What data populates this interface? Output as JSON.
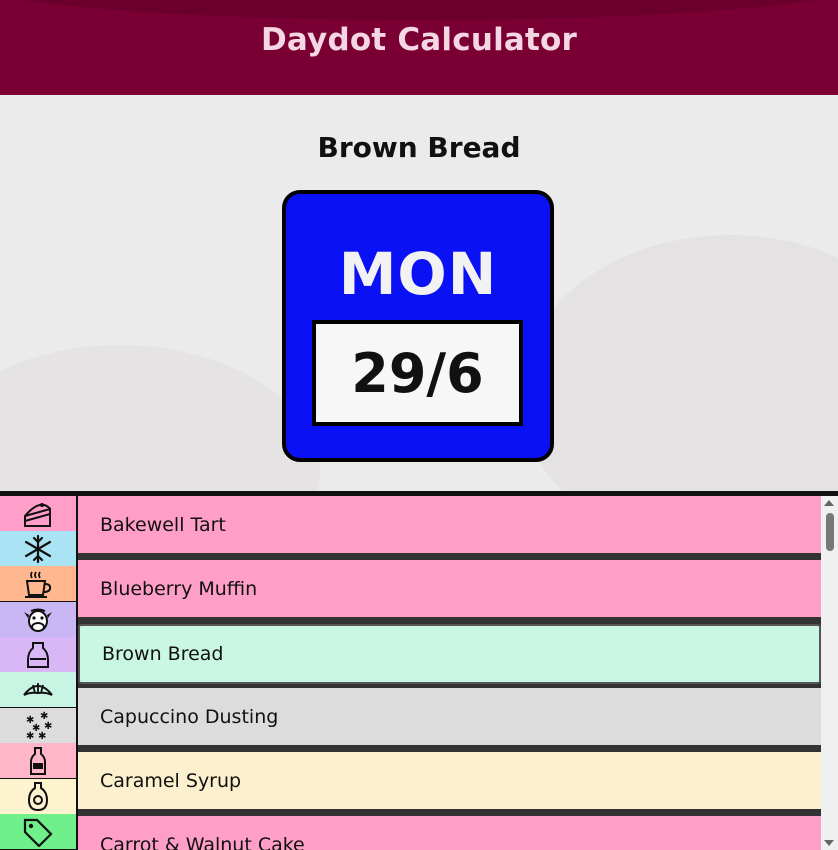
{
  "header": {
    "title": "Daydot Calculator"
  },
  "result": {
    "food_name": "Brown Bread",
    "day": "MON",
    "date": "29/6",
    "daydot_color": "#0a12f5"
  },
  "categories": [
    {
      "name": "cake-icon",
      "color": "#ff9ec8"
    },
    {
      "name": "snowflake-icon",
      "color": "#a9e3f4"
    },
    {
      "name": "hot-drink-icon",
      "color": "#ffb790"
    },
    {
      "name": "cow-icon",
      "color": "#c9b7f5"
    },
    {
      "name": "carafe-icon",
      "color": "#d9b6f5"
    },
    {
      "name": "croissant-icon",
      "color": "#c8f5e3"
    },
    {
      "name": "sprinkles-icon",
      "color": "#dcdcdc"
    },
    {
      "name": "bottle-icon",
      "color": "#ffb6c8"
    },
    {
      "name": "syrup-bottle-icon",
      "color": "#fdf3cf"
    },
    {
      "name": "tag-icon",
      "color": "#6ff08a"
    }
  ],
  "items": [
    {
      "label": "Bakewell Tart",
      "color": "#ff9fc8"
    },
    {
      "label": "Blueberry Muffin",
      "color": "#ff9fc8"
    },
    {
      "label": "Brown Bread",
      "color": "#c9f7e3"
    },
    {
      "label": "Capuccino Dusting",
      "color": "#dcdcdc"
    },
    {
      "label": "Caramel Syrup",
      "color": "#fdf0cf"
    },
    {
      "label": "Carrot & Walnut Cake",
      "color": "#ff9fc8"
    }
  ]
}
